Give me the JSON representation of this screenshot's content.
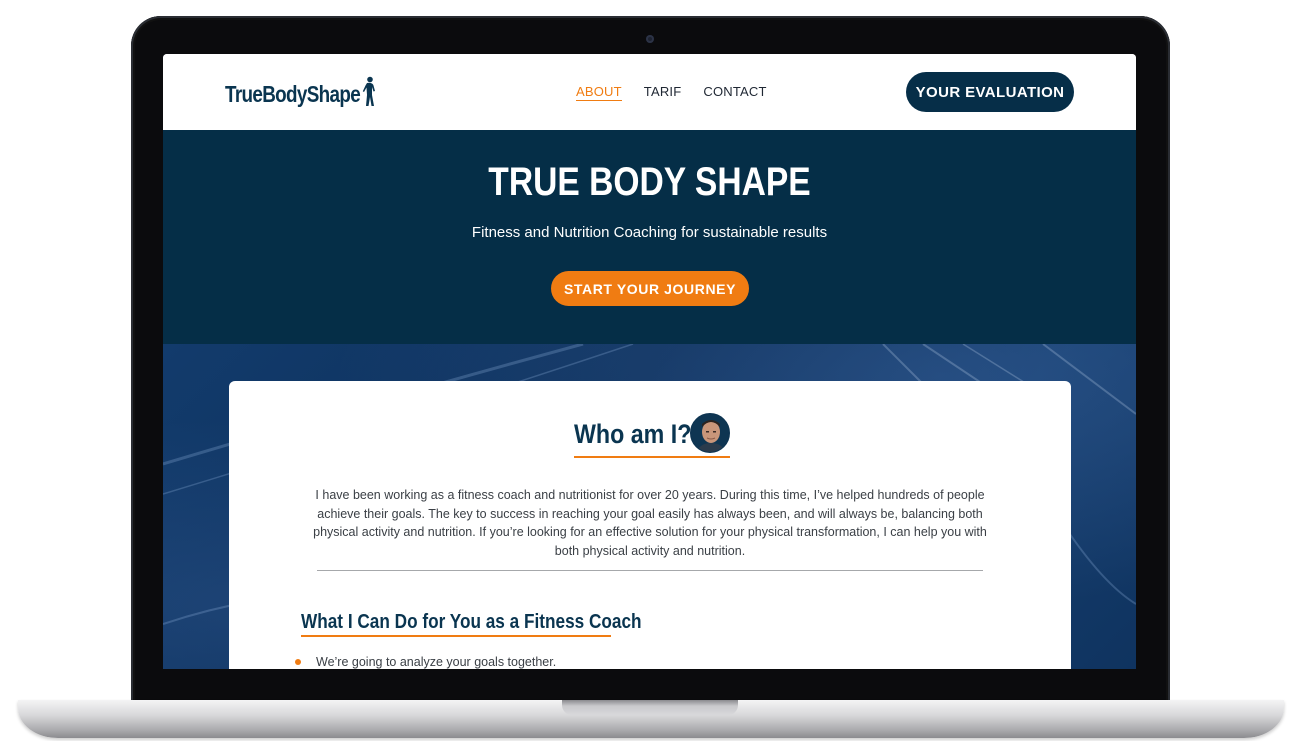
{
  "nav": {
    "logo_text": "TrueBodyShape",
    "links": [
      {
        "label": "ABOUT",
        "active": true
      },
      {
        "label": "TARIF",
        "active": false
      },
      {
        "label": "CONTACT",
        "active": false
      }
    ],
    "cta_label": "YOUR EVALUATION"
  },
  "hero": {
    "title": "TRUE BODY SHAPE",
    "subtitle": "Fitness and Nutrition Coaching for sustainable results",
    "button_label": "START YOUR JOURNEY"
  },
  "about": {
    "heading": "Who am I?",
    "bio": "I have been working as a fitness coach and nutritionist for over 20 years. During this time, I’ve helped hundreds of people achieve their goals. The key to success in reaching your goal easily has always been, and will always be, balancing both physical activity and nutrition. If you’re looking for an effective solution for your physical transformation, I can help you with both physical activity and nutrition."
  },
  "services": {
    "heading": "What I Can Do for You as a Fitness Coach",
    "items": [
      "We’re going to analyze your goals together."
    ]
  },
  "colors": {
    "brand_navy": "#052e47",
    "accent_orange": "#f07c12",
    "background_blue": "#123b6c"
  },
  "icons": {
    "logo_figure": "silhouette-figure-icon",
    "avatar": "coach-portrait",
    "bullet": "orange-dot-icon"
  }
}
